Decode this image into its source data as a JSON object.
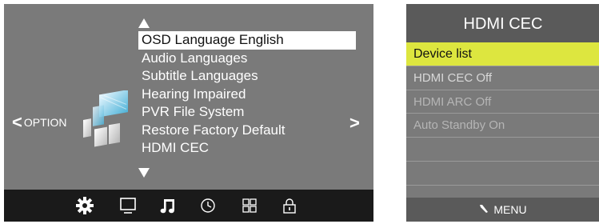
{
  "osd": {
    "menu_items": [
      "OSD Language English",
      "Audio Languages",
      "Subtitle Languages",
      "Hearing Impaired",
      "PVR File System",
      "Restore Factory Default",
      "HDMI CEC"
    ],
    "selected_index": 0,
    "option_label": "OPTION",
    "nav_left_glyph": "<",
    "nav_right_glyph": ">",
    "tabs": [
      {
        "name": "gear-icon"
      },
      {
        "name": "monitor-icon"
      },
      {
        "name": "music-note-icon"
      },
      {
        "name": "clock-icon"
      },
      {
        "name": "grid-icon"
      },
      {
        "name": "lock-icon"
      }
    ],
    "colors": {
      "panel": "#7a7a7a",
      "tabbar": "#1a1a1a",
      "highlight": "#ffffff"
    }
  },
  "cec": {
    "title": "HDMI CEC",
    "rows": [
      {
        "label": "Device list",
        "state": "active"
      },
      {
        "label": "HDMI CEC Off",
        "state": "normal"
      },
      {
        "label": "HDMI ARC Off",
        "state": "dim"
      },
      {
        "label": "Auto Standby On",
        "state": "dim"
      },
      {
        "label": "",
        "state": "empty"
      },
      {
        "label": "",
        "state": "empty"
      },
      {
        "label": "",
        "state": "empty"
      }
    ],
    "footer_label": "MENU",
    "colors": {
      "active_row": "#dde63f",
      "header": "#5a5a5a"
    }
  }
}
